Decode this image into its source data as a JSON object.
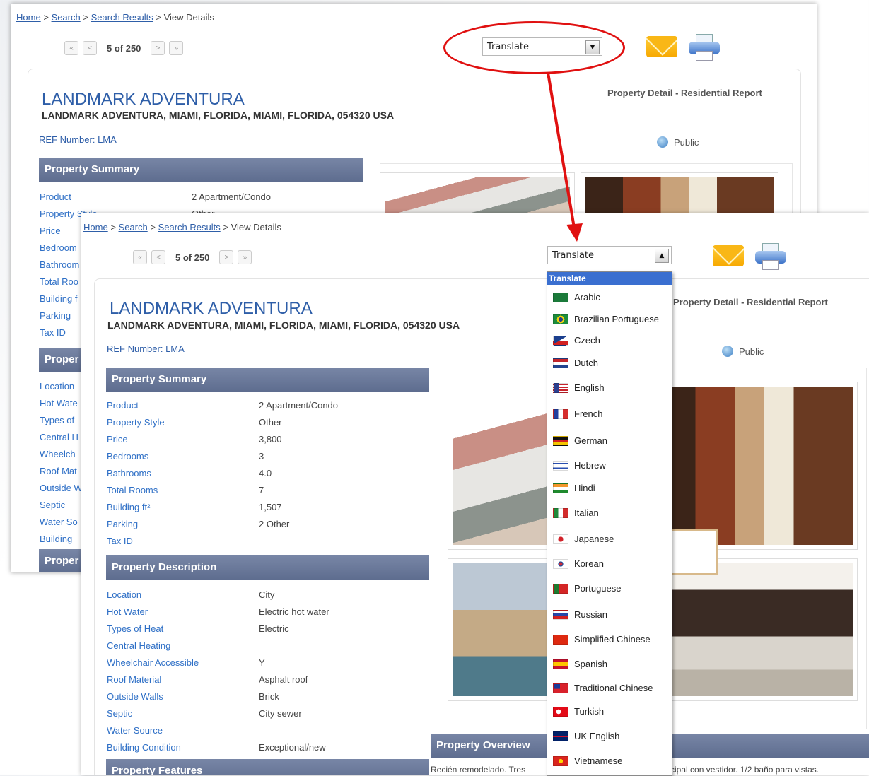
{
  "breadcrumb": {
    "home": "Home",
    "sep": ">",
    "search": "Search",
    "results": "Search Results",
    "current": "View Details"
  },
  "pager": {
    "first": "«",
    "prev": "<",
    "count": "5 of 250",
    "next": ">",
    "last": "»"
  },
  "translate": {
    "label": "Translate",
    "arrow_closed": "▼",
    "arrow_open": "▲"
  },
  "property": {
    "name": "LANDMARK ADVENTURA",
    "address": "LANDMARK ADVENTURA, MIAMI, FLORIDA, MIAMI, FLORIDA, 054320 USA",
    "ref": "REF Number: LMA",
    "report_title": "Property Detail - Residential Report",
    "visibility": "Public"
  },
  "summary": {
    "heading": "Property Summary",
    "rows": [
      {
        "k": "Product",
        "v": "2 Apartment/Condo"
      },
      {
        "k": "Property Style",
        "v": "Other"
      },
      {
        "k": "Price",
        "v": "3,800"
      },
      {
        "k": "Bedrooms",
        "v": "3"
      },
      {
        "k": "Bathrooms",
        "v": "4.0"
      },
      {
        "k": "Total Rooms",
        "v": "7"
      },
      {
        "k": "Building ft²",
        "v": "1,507"
      },
      {
        "k": "Parking",
        "v": "2 Other"
      },
      {
        "k": "Tax ID",
        "v": ""
      }
    ]
  },
  "description": {
    "heading": "Property Description",
    "rows": [
      {
        "k": "Location",
        "v": "City"
      },
      {
        "k": "Hot Water",
        "v": "Electric hot water"
      },
      {
        "k": "Types of Heat",
        "v": "Electric"
      },
      {
        "k": "Central Heating",
        "v": ""
      },
      {
        "k": "Wheelchair Accessible",
        "v": "Y"
      },
      {
        "k": "Roof Material",
        "v": "Asphalt roof"
      },
      {
        "k": "Outside Walls",
        "v": "Brick"
      },
      {
        "k": "Septic",
        "v": "City sewer"
      },
      {
        "k": "Water Source",
        "v": ""
      },
      {
        "k": "Building Condition",
        "v": "Exceptional/new"
      }
    ]
  },
  "back_partial_rows": [
    "Location",
    "Hot Wate",
    "Types of",
    "Central H",
    "Wheelch",
    "Roof Mat",
    "Outside W",
    "Septic",
    "Water So",
    "Building"
  ],
  "back_partial_heading": "Proper",
  "back_partial_summary": [
    "Product",
    "Property Style",
    "Price",
    "Bedroom",
    "Bathroom",
    "Total Roo",
    "Building f",
    "Parking",
    "Tax ID"
  ],
  "features_heading": "Property Features",
  "overview": {
    "heading": "Property Overview",
    "text_left": "Recién remodelado. Tres",
    "text_right": "cipal con vestidor. 1/2 baño para vistas."
  },
  "dropdown": {
    "header": "Translate",
    "languages": [
      {
        "name": "Arabic",
        "flag": "flag-sa"
      },
      {
        "name": "Brazilian Portuguese",
        "flag": "flag-br"
      },
      {
        "name": "Czech",
        "flag": "flag-cz"
      },
      {
        "name": "Dutch",
        "flag": "flag-nl"
      },
      {
        "name": "English",
        "flag": "flag-us"
      },
      {
        "name": "French",
        "flag": "flag-fr"
      },
      {
        "name": "German",
        "flag": "flag-de"
      },
      {
        "name": "Hebrew",
        "flag": "flag-il"
      },
      {
        "name": "Hindi",
        "flag": "flag-in"
      },
      {
        "name": "Italian",
        "flag": "flag-it"
      },
      {
        "name": "Japanese",
        "flag": "flag-jp"
      },
      {
        "name": "Korean",
        "flag": "flag-kr"
      },
      {
        "name": "Portuguese",
        "flag": "flag-pt"
      },
      {
        "name": "Russian",
        "flag": "flag-ru"
      },
      {
        "name": "Simplified Chinese",
        "flag": "flag-cn"
      },
      {
        "name": "Spanish",
        "flag": "flag-es"
      },
      {
        "name": "Traditional Chinese",
        "flag": "flag-tw"
      },
      {
        "name": "Turkish",
        "flag": "flag-tr"
      },
      {
        "name": "UK English",
        "flag": "flag-gb"
      },
      {
        "name": "Vietnamese",
        "flag": "flag-vn"
      }
    ]
  },
  "colors": {
    "accent": "#2e5ea8",
    "section_header": "#6a789a",
    "callout": "#e01010",
    "dropdown_highlight": "#3a6fd0"
  }
}
